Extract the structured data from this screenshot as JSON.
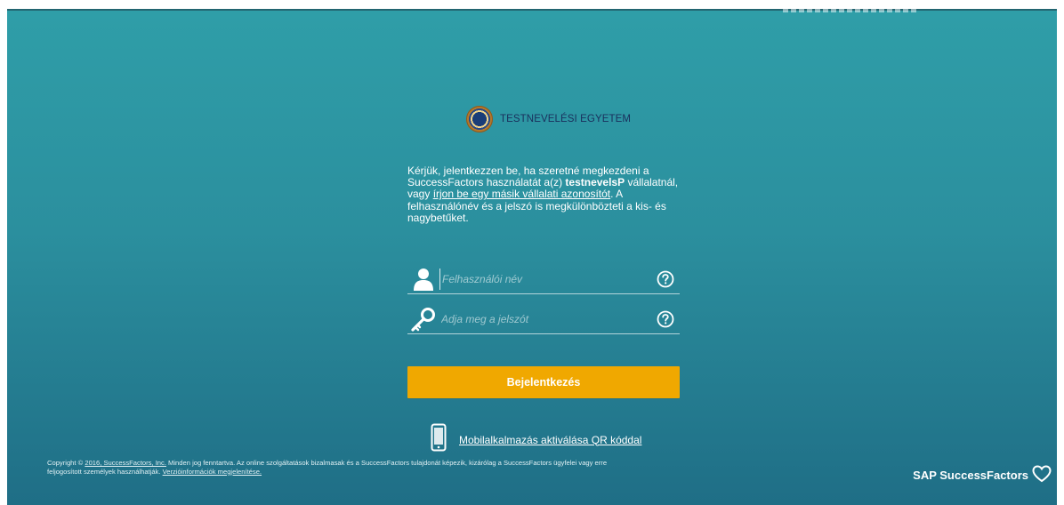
{
  "header": {
    "university_name": "TESTNEVELÉSI EGYETEM"
  },
  "intro": {
    "part1": "Kérjük, jelentkezzen be, ha szeretné megkezdeni a SuccessFactors használatát a(z) ",
    "company_id": "testnevelsP",
    "part2": " vállalatnál, vagy ",
    "other_company_link": "írjon be egy másik vállalati azonosítót",
    "part3": ". A felhasználónév és a jelszó is megkülönbözteti a kis- és nagybetűket."
  },
  "login": {
    "username_placeholder": "Felhasználói név",
    "password_placeholder": "Adja meg a jelszót",
    "submit_label": "Bejelentkezés"
  },
  "mobile": {
    "qr_link": "Mobilalkalmazás aktiválása QR kóddal"
  },
  "footer": {
    "copyright_prefix": "Copyright ©",
    "copyright_link": "2016, SuccessFactors, Inc.",
    "copyright_text": " Minden jog fenntartva. Az online szolgáltatások bizalmasak és a SuccessFactors tulajdonát képezik, kizárólag a SuccessFactors ügyfelei vagy erre feljogosított személyek használhatják.",
    "version_link": "Verzióinformációk megjelenítése."
  },
  "brand": {
    "name": "SAP SuccessFactors"
  },
  "colors": {
    "accent": "#f0a800",
    "background_top": "#2f9ea8",
    "background_bottom": "#1f6e86"
  },
  "icons": [
    "user-icon",
    "key-icon",
    "help-icon",
    "phone-icon",
    "heart-icon",
    "university-seal-icon"
  ]
}
